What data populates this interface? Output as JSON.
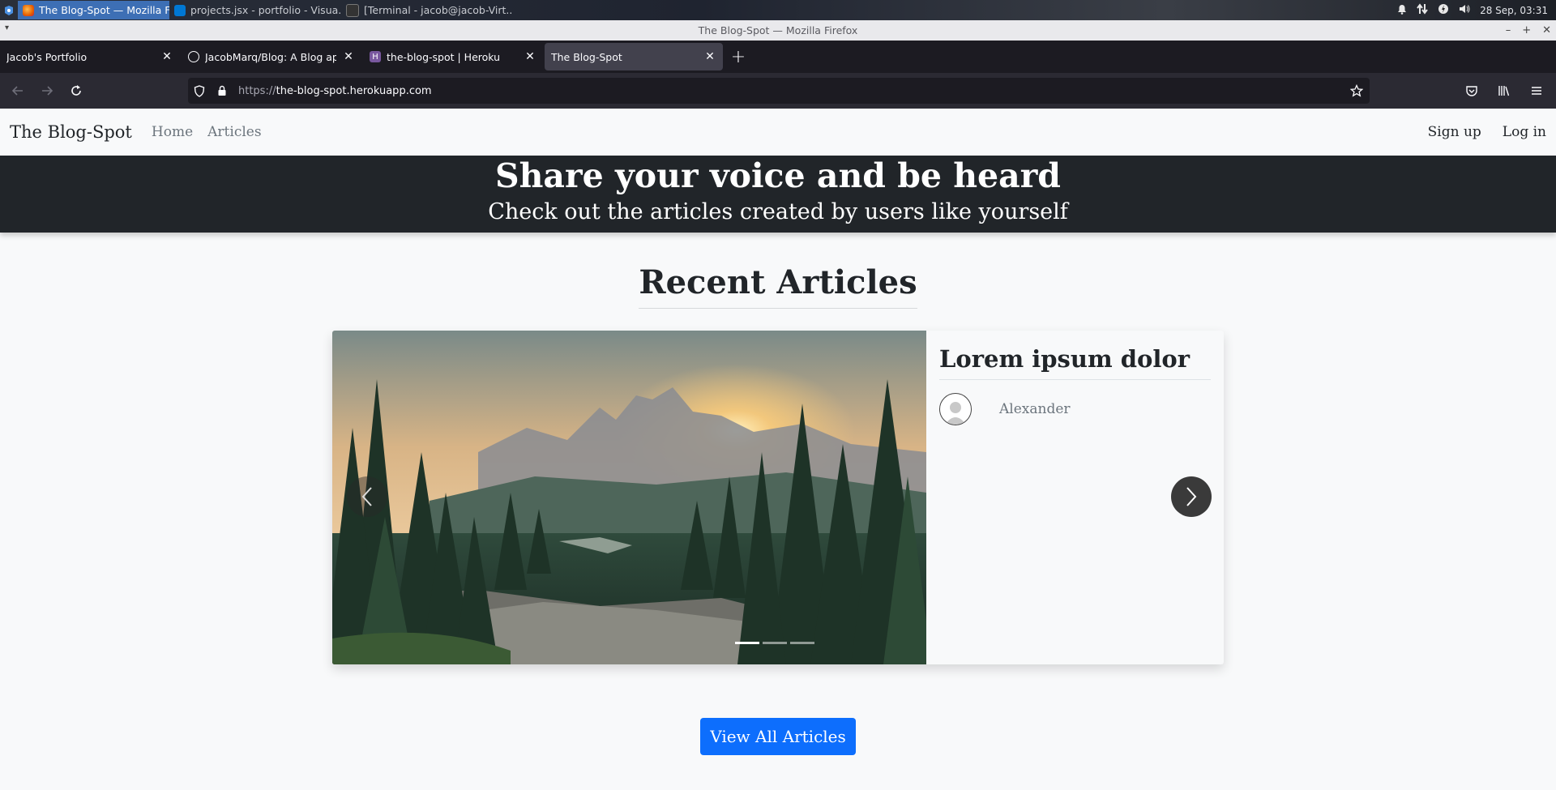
{
  "taskbar": {
    "tasks": [
      {
        "label": "The Blog-Spot — Mozilla Fire...",
        "active": true
      },
      {
        "label": "projects.jsx - portfolio - Visua..."
      },
      {
        "label": "[Terminal - jacob@jacob-Virt..."
      }
    ],
    "clock": "28 Sep, 03:31"
  },
  "window": {
    "title": "The Blog-Spot — Mozilla Firefox"
  },
  "tabs": [
    {
      "label": "Jacob's Portfolio"
    },
    {
      "label": "JacobMarq/Blog: A Blog app d"
    },
    {
      "label": "the-blog-spot | Heroku"
    },
    {
      "label": "The Blog-Spot",
      "active": true
    }
  ],
  "urlbar": {
    "scheme": "https://",
    "host": "the-blog-spot.herokuapp.com"
  },
  "site": {
    "brand": "The Blog-Spot",
    "nav": {
      "home": "Home",
      "articles": "Articles",
      "signup": "Sign up",
      "login": "Log in"
    },
    "hero": {
      "headline": "Share your voice and be heard",
      "subheadline": "Check out the articles created by users like yourself"
    },
    "recent_title": "Recent Articles",
    "carousel": {
      "slide_title": "Lorem ipsum dolor",
      "author": "Alexander",
      "slide_count": 3,
      "active_slide": 1
    },
    "cta": "View All Articles"
  },
  "colors": {
    "accent": "#0d6efd",
    "hero_bg": "#212529",
    "tab_active": "#42414d"
  }
}
